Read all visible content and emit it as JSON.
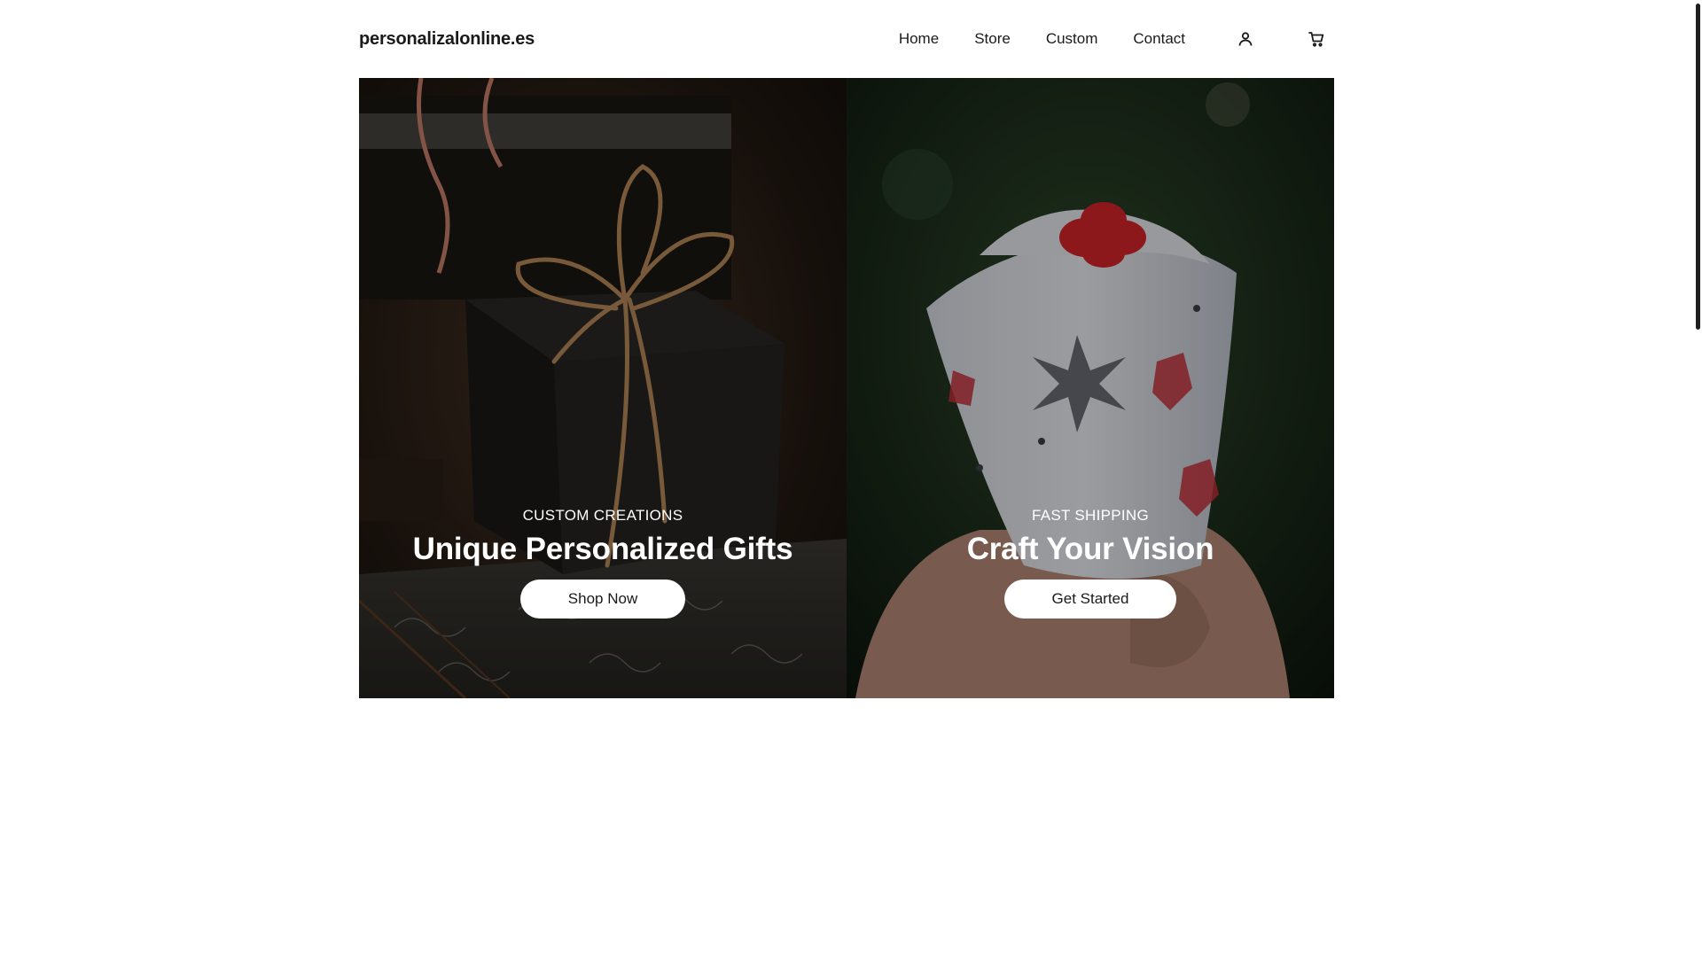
{
  "header": {
    "logo": "personalizalonline.es",
    "nav": [
      "Home",
      "Store",
      "Custom",
      "Contact"
    ],
    "icons": [
      "account-icon",
      "cart-icon"
    ]
  },
  "hero": {
    "left": {
      "eyebrow": "CUSTOM CREATIONS",
      "headline": "Unique Personalized Gifts",
      "button": "Shop Now",
      "image": "black gift box tied with twine"
    },
    "right": {
      "eyebrow": "FAST SHIPPING",
      "headline": "Craft Your Vision",
      "button": "Get Started",
      "image": "hand holding wrapped gift with red bow"
    }
  },
  "colors": {
    "text": "#1a1a1a",
    "background": "#ffffff",
    "button": "#ffffff"
  }
}
